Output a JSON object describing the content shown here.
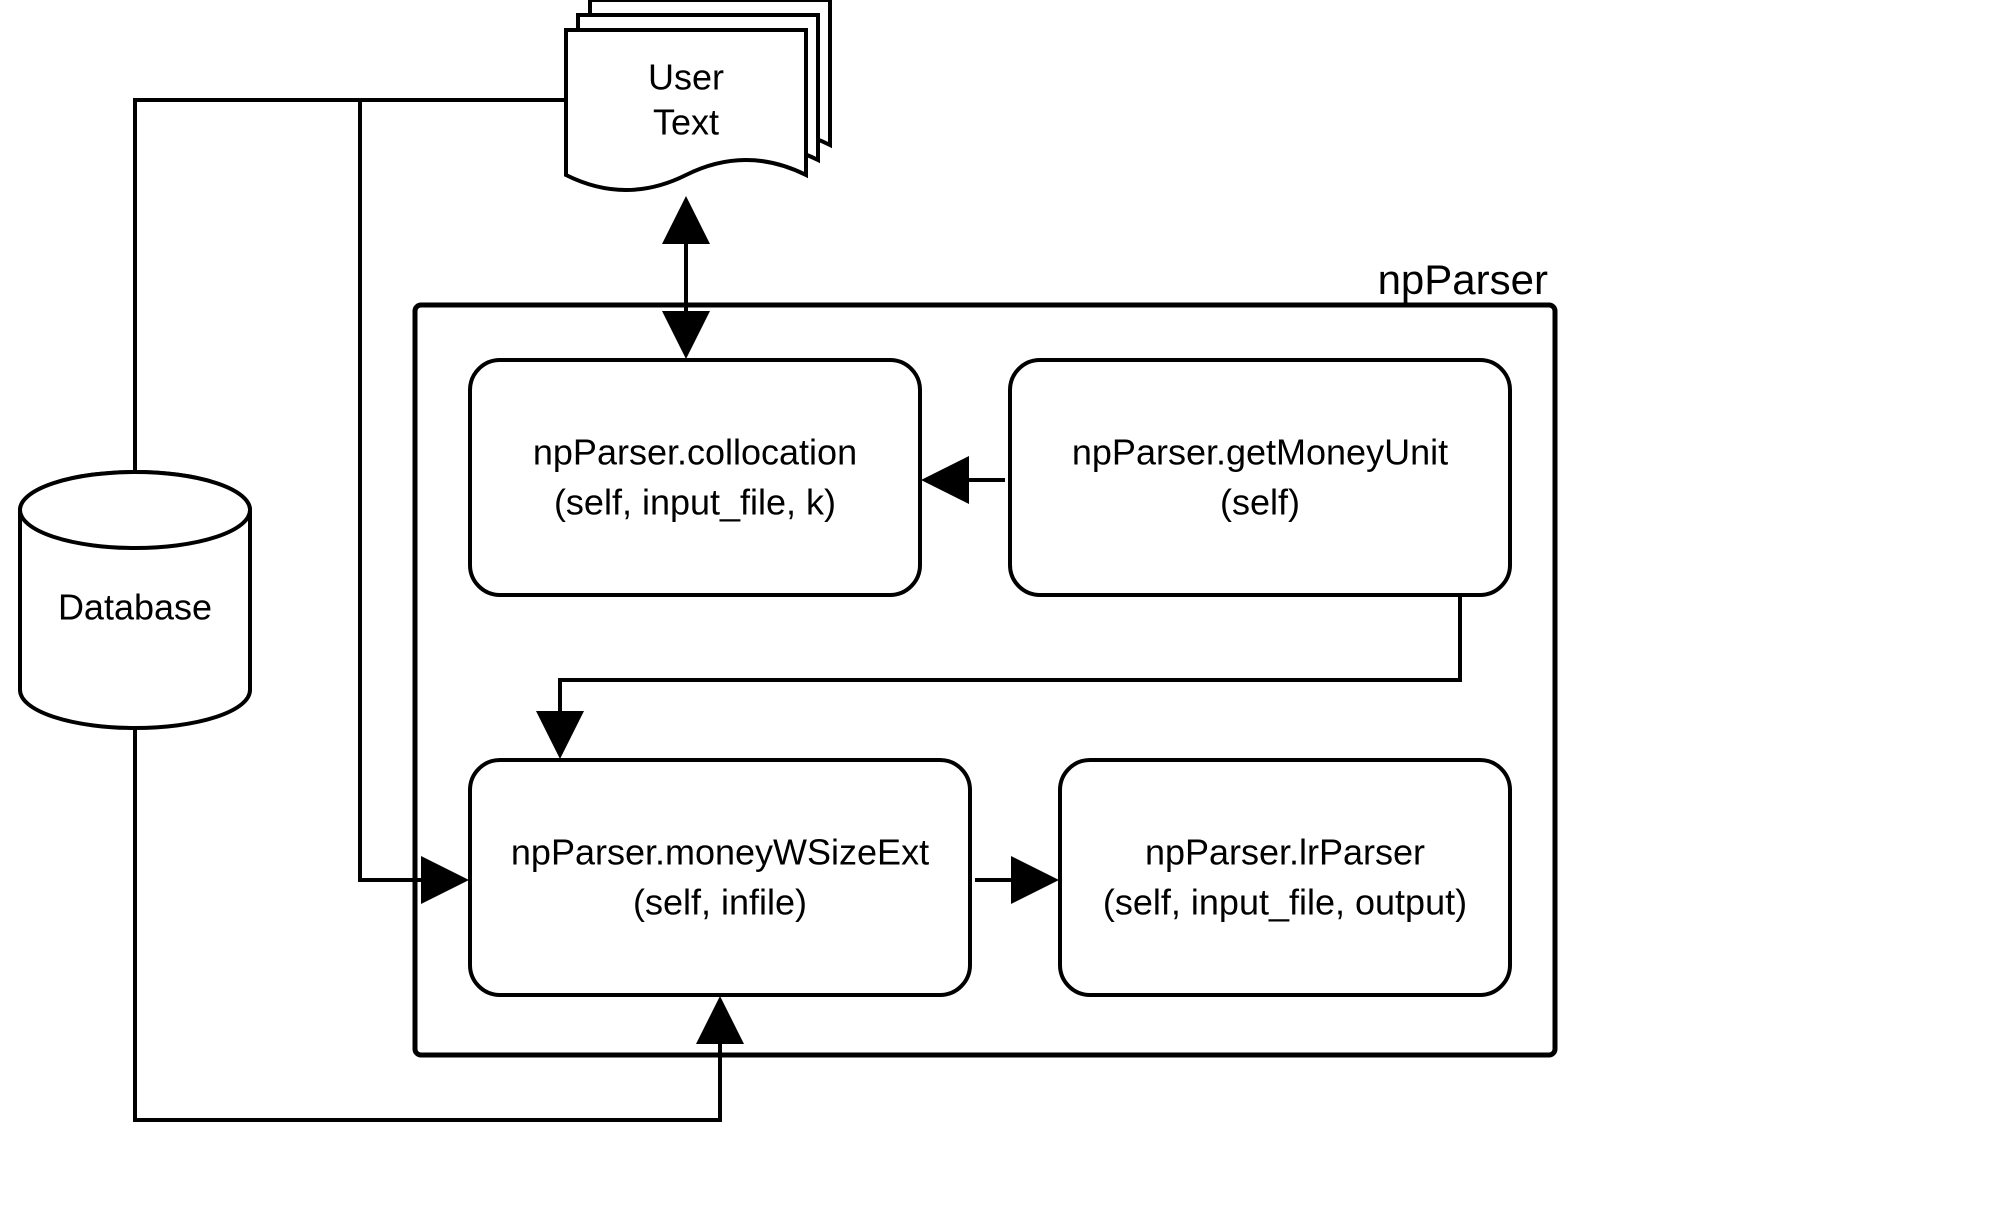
{
  "diagram": {
    "title": "npParser",
    "database": {
      "label": "Database"
    },
    "userText": {
      "line1": "User",
      "line2": "Text"
    },
    "collocation": {
      "line1": "npParser.collocation",
      "line2": "(self, input_file, k)"
    },
    "getMoneyUnit": {
      "line1": "npParser.getMoneyUnit",
      "line2": "(self)"
    },
    "moneyWSizeExt": {
      "line1": "npParser.moneyWSizeExt",
      "line2": "(self, infile)"
    },
    "lrParser": {
      "line1": "npParser.lrParser",
      "line2": "(self, input_file, output)"
    }
  }
}
